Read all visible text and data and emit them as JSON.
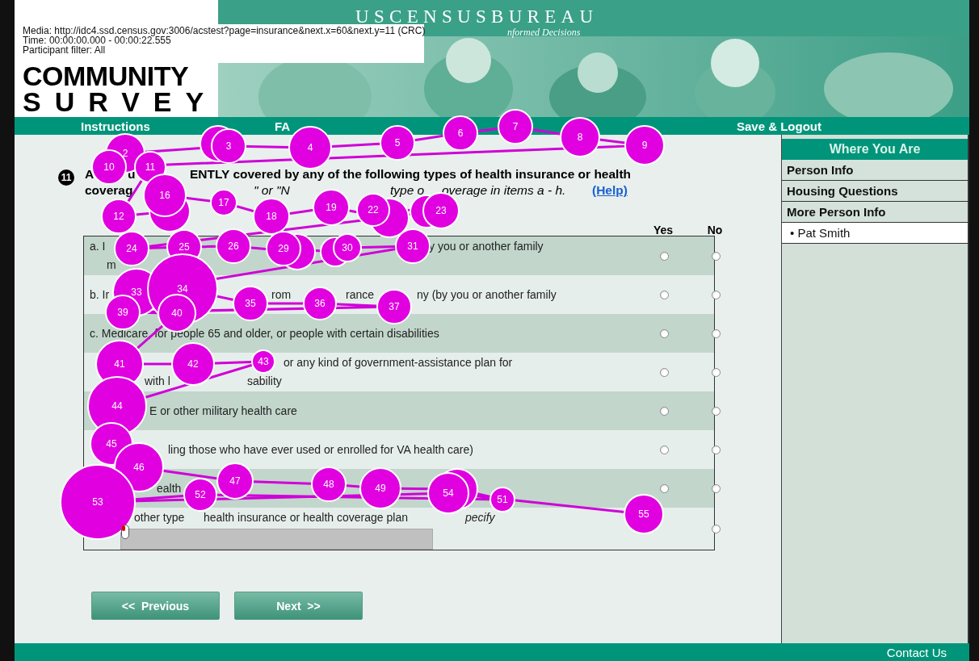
{
  "overlay_info": {
    "media": "Media: http://idc4.ssd.census.gov:3006/acstest?page=insurance&next.x=60&next.y=11 (CRC)",
    "time": "Time: 00:00:00.000 - 00:00:22.555",
    "filter": "Participant filter: All"
  },
  "header": {
    "agency": "USCENSUSBUREAU",
    "tagline": "nformed Decisions",
    "logo_line1": "COMMUNITY",
    "logo_line2": "SURVEY"
  },
  "nav": [
    {
      "label": "Instructions"
    },
    {
      "label": "FA"
    },
    {
      "label": "Save & Logout"
    }
  ],
  "question": {
    "number": "11",
    "lines": [
      [
        "A",
        "u",
        "ENTLY covered by any of the following types of health insurance or health"
      ],
      [
        "coverag",
        "\" or \"N",
        "type o",
        "overage in items a - h."
      ]
    ],
    "help_link": "(Help)"
  },
  "columns": [
    "Yes",
    "No"
  ],
  "rows": [
    {
      "kind": "plain",
      "lines": [
        [
          "a. I",
          "y you or another family"
        ],
        [
          "m"
        ]
      ],
      "yes": {
        "selected": false
      },
      "no": {
        "selected": false
      }
    },
    {
      "kind": "plain",
      "lines": [
        [
          "b. Ir",
          "rom",
          "rance",
          "ny (by you or another family"
        ]
      ],
      "yes": {
        "selected": false
      },
      "no": {
        "selected": false
      }
    },
    {
      "kind": "plain",
      "lines": [
        [
          "c. Medicare, for people 65 and older, or people with certain disabilities"
        ]
      ],
      "yes": {
        "selected": false
      },
      "no": {
        "selected": false
      }
    },
    {
      "kind": "plain",
      "lines": [
        [
          "or any kind of government-assistance plan for"
        ],
        [
          "with l",
          "sability"
        ]
      ],
      "yes": {
        "selected": false
      },
      "no": {
        "selected": false
      }
    },
    {
      "kind": "plain",
      "lines": [
        [
          "E or other military health care"
        ]
      ],
      "yes": {
        "selected": false
      },
      "no": {
        "selected": false
      }
    },
    {
      "kind": "plain",
      "lines": [
        [
          "ling those who have ever used or enrolled for VA health care)"
        ]
      ],
      "yes": {
        "selected": false
      },
      "no": {
        "selected": false
      }
    },
    {
      "kind": "plain",
      "lines": [
        [
          "ealth"
        ]
      ],
      "yes": {
        "selected": false
      },
      "no": {
        "selected": false
      }
    },
    {
      "kind": "specify",
      "lines": [
        [
          "other type",
          "health insurance or health coverage plan",
          "pecify"
        ]
      ],
      "no": {
        "selected": false
      }
    }
  ],
  "buttons": [
    "<<  Previous",
    "Next  >>"
  ],
  "sidebar": {
    "title": "Where You Are",
    "items": [
      {
        "label": "Person Info",
        "selected": false
      },
      {
        "label": "Housing Questions",
        "selected": false
      },
      {
        "label": "More Person Info",
        "selected": false,
        "children": [
          {
            "label": "• Pat Smith",
            "selected": true
          }
        ]
      }
    ]
  },
  "footer": {
    "link": "Contact Us"
  },
  "gaze_plot": {
    "fixations": [
      {
        "number": "2"
      },
      {
        "number": "3"
      },
      {
        "number": "4"
      },
      {
        "number": "5"
      },
      {
        "number": "6"
      },
      {
        "number": "7"
      },
      {
        "number": "8"
      },
      {
        "number": "9"
      },
      {
        "number": "10"
      },
      {
        "number": "11"
      },
      {
        "number": "12"
      },
      {
        "number": "16"
      },
      {
        "number": "17"
      },
      {
        "number": "18"
      },
      {
        "number": "19"
      },
      {
        "number": "22"
      },
      {
        "number": "23"
      },
      {
        "number": "24"
      },
      {
        "number": "25"
      },
      {
        "number": "26"
      },
      {
        "number": "29"
      },
      {
        "number": "30"
      },
      {
        "number": "31"
      },
      {
        "number": "33"
      },
      {
        "number": "34"
      },
      {
        "number": "35"
      },
      {
        "number": "36"
      },
      {
        "number": "37"
      },
      {
        "number": "39"
      },
      {
        "number": "40"
      },
      {
        "number": "41"
      },
      {
        "number": "42"
      },
      {
        "number": "43"
      },
      {
        "number": "44"
      },
      {
        "number": "45"
      },
      {
        "number": "46"
      },
      {
        "number": "47"
      },
      {
        "number": "48"
      },
      {
        "number": "49"
      },
      {
        "number": "51"
      },
      {
        "number": "52"
      },
      {
        "number": "53"
      },
      {
        "number": "54"
      },
      {
        "number": "55"
      }
    ]
  }
}
